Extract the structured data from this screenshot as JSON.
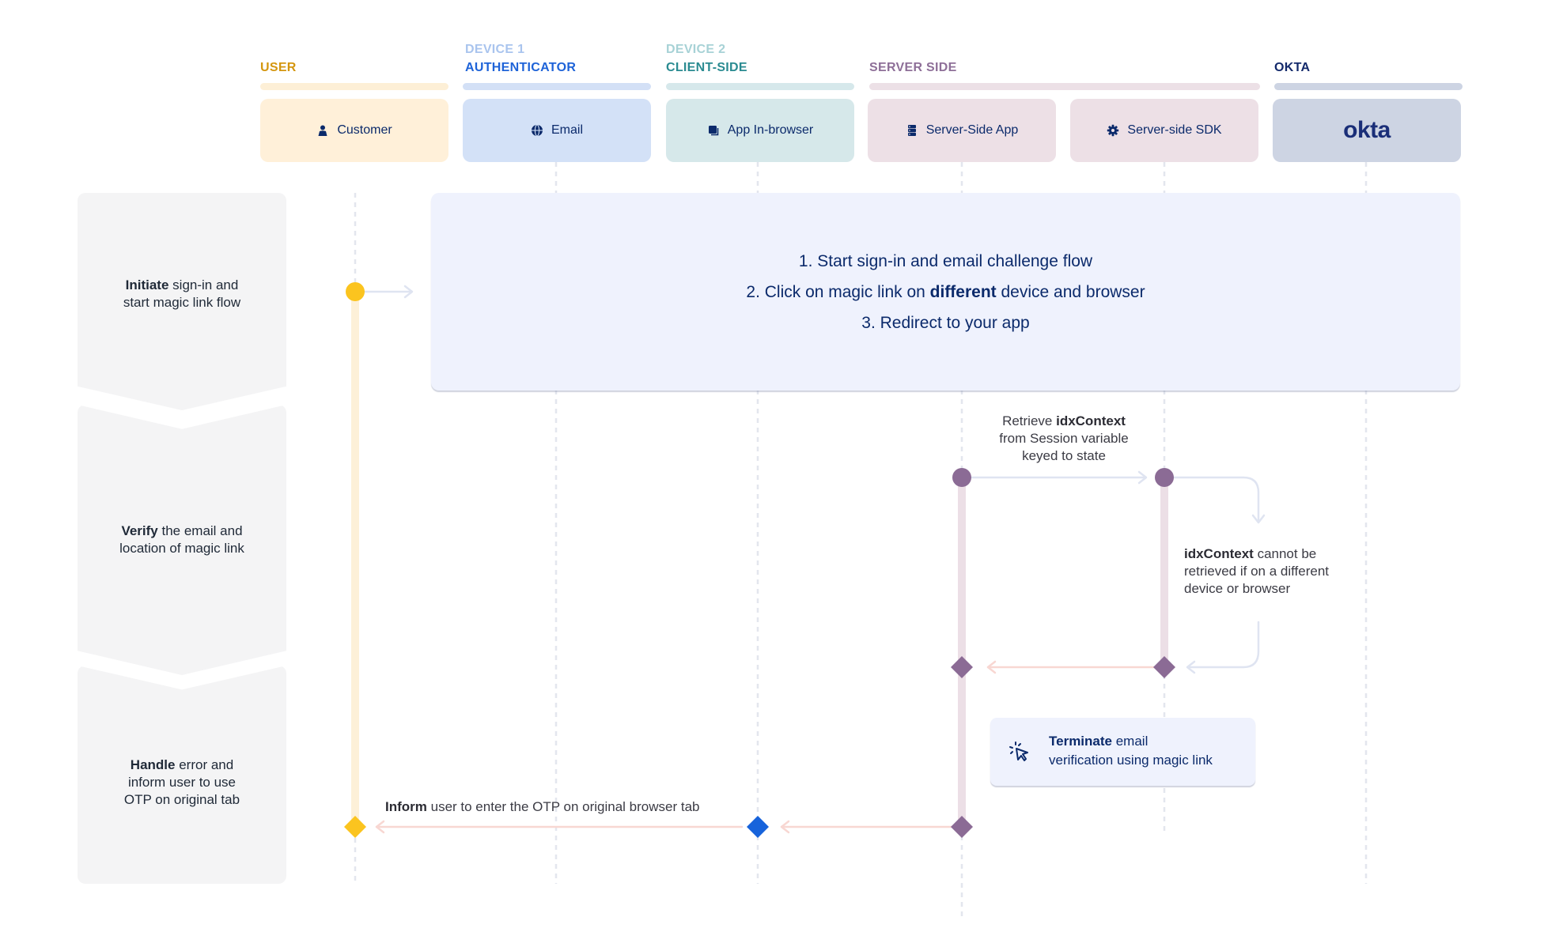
{
  "lanes": [
    {
      "id": "user",
      "group_sub": "",
      "group_label": "USER",
      "card_label": "Customer",
      "icon": "person-icon",
      "label_color": "#d4960f",
      "bar_color": "#fdefd6",
      "card_color": "#fff0d9"
    },
    {
      "id": "email",
      "group_sub": "DEVICE 1",
      "group_label": "AUTHENTICATOR",
      "card_label": "Email",
      "icon": "globe-icon",
      "label_color": "#1e63d8",
      "sub_color": "#a9c4ee",
      "bar_color": "#d3e0f6",
      "card_color": "#d3e1f7"
    },
    {
      "id": "app",
      "group_sub": "DEVICE 2",
      "group_label": "CLIENT-SIDE",
      "card_label": "App In-browser",
      "icon": "browser-window-icon",
      "label_color": "#2a8b91",
      "sub_color": "#a7d2d6",
      "bar_color": "#d6e8eb",
      "card_color": "#d6e8ea"
    },
    {
      "id": "server_app",
      "group_sub": "",
      "group_label": "SERVER SIDE",
      "card_label": "Server-Side App",
      "icon": "server-icon",
      "label_color": "#8e6f98",
      "bar_color": "#ece0e6",
      "card_color": "#ede0e6"
    },
    {
      "id": "sdk",
      "group_sub": "",
      "group_label": "",
      "card_label": "Server-side SDK",
      "icon": "gear-icon",
      "label_color": "#8e6f98",
      "bar_color": "#ece0e6",
      "card_color": "#ede0e6"
    },
    {
      "id": "okta",
      "group_sub": "",
      "group_label": "OKTA",
      "card_label": "okta",
      "icon": "okta-logo",
      "label_color": "#13296b",
      "bar_color": "#cdd4e3",
      "card_color": "#cdd4e3"
    }
  ],
  "steps": [
    {
      "bold": "Initiate",
      "line1_rest": " sign-in and",
      "line2": "start magic link flow",
      "line3": ""
    },
    {
      "bold": "Verify",
      "line1_rest": " the email and",
      "line2": "location of magic link",
      "line3": ""
    },
    {
      "bold": "Handle",
      "line1_rest": " error and",
      "line2": "inform user to use",
      "line3": "OTP on original tab"
    }
  ],
  "summary_box": {
    "line1": "1. Start sign-in and email challenge flow",
    "line2_pre": "2. Click on magic link on ",
    "line2_bold": "different",
    "line2_post": " device and browser",
    "line3": "3. Redirect to your app"
  },
  "notes": {
    "retrieve": {
      "pre": "Retrieve ",
      "bold": "idxContext",
      "line2": "from Session variable",
      "line3": "keyed to state"
    },
    "cannot": {
      "bold": "idxContext",
      "line1_rest": " cannot be",
      "line2": "retrieved if on a different",
      "line3": "device or browser"
    },
    "terminate": {
      "bold": "Terminate",
      "line1_rest": " email",
      "line2": "verification using magic link",
      "icon": "cursor-click-icon"
    },
    "inform": {
      "bold": "Inform",
      "rest": " user to enter the OTP on original browser tab"
    }
  },
  "colors": {
    "user_marker": "#fbc41f",
    "server_marker": "#8b6b95",
    "device_marker": "#1763db",
    "user_activation": "#fdf0d8",
    "server_activation": "#ecdfe6",
    "lifeline": "#e3e6ee",
    "arrow_forward": "#dfe4f1",
    "arrow_return": "#f8d7d2",
    "text_navy": "#0b2a6b"
  }
}
